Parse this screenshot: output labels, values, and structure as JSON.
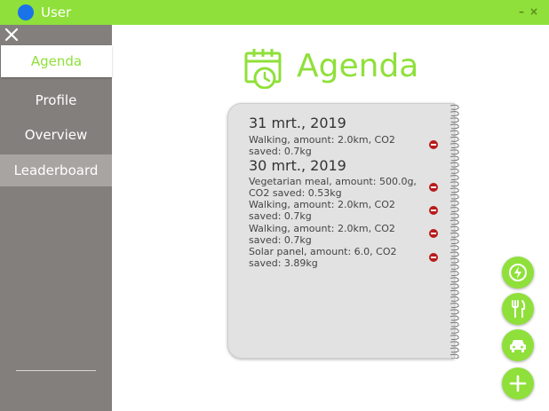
{
  "window": {
    "title": "User"
  },
  "sidebar": {
    "items": [
      {
        "label": "Agenda",
        "active": true
      },
      {
        "label": "Profile"
      },
      {
        "label": "Overview"
      },
      {
        "label": "Leaderboard",
        "highlighted": true
      }
    ]
  },
  "header": {
    "title": "Agenda",
    "icon": "calendar-clock-icon"
  },
  "agenda": {
    "days": [
      {
        "date": "31 mrt., 2019",
        "entries": [
          {
            "line1": "Walking, amount: 2.0km, CO2",
            "line2": "saved: 0.7kg"
          }
        ]
      },
      {
        "date": "30 mrt., 2019",
        "entries": [
          {
            "line1": "Vegetarian meal, amount: 500.0g,",
            "line2": "CO2 saved: 0.53kg"
          },
          {
            "line1": "Walking, amount: 2.0km, CO2",
            "line2": "saved: 0.7kg"
          },
          {
            "line1": "Walking, amount: 2.0km, CO2",
            "line2": "saved: 0.7kg"
          },
          {
            "line1": "Solar panel, amount: 6.0, CO2",
            "line2": "saved: 3.89kg"
          }
        ]
      }
    ]
  },
  "fabs": [
    "energy-icon",
    "food-icon",
    "car-icon",
    "add-icon"
  ],
  "colors": {
    "accent": "#8fe03a",
    "sidebar": "#837f7c",
    "delete": "#b71c1c",
    "app_dot": "#1a73e8"
  }
}
